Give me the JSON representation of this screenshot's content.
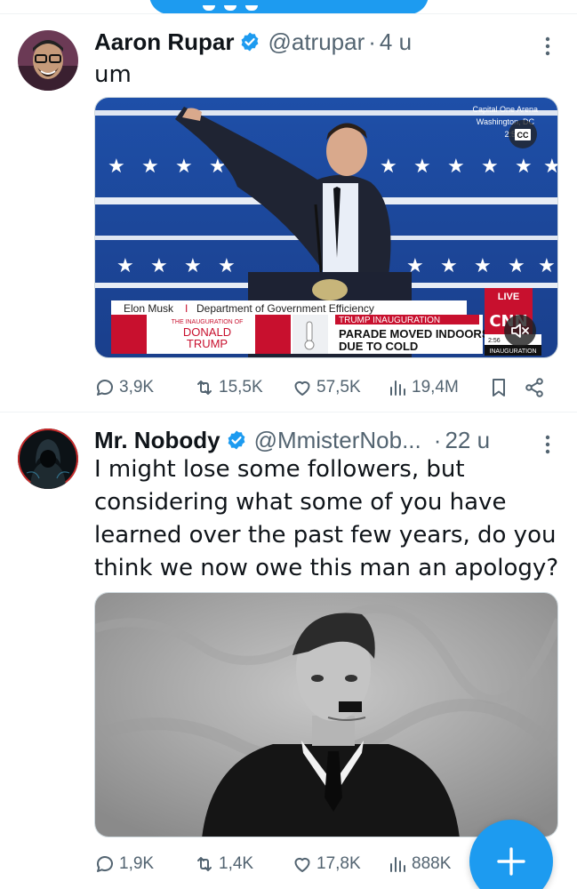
{
  "tweets": [
    {
      "name": "Aaron Rupar",
      "handle": "@atrupar",
      "separator": "·",
      "time": "4 u",
      "text": "um",
      "media": {
        "location_line1": "Capital One Arena",
        "location_line2": "Washington, DC",
        "clock": "2:55",
        "cc_label": "CC",
        "live_label": "LIVE",
        "network_logo": "CNN",
        "chyron_name": "Elon Musk",
        "chyron_divider": "I",
        "chyron_role": "Department of Government Efficiency",
        "inaug_line1": "THE INAUGURATION OF",
        "inaug_line2": "DONALD",
        "inaug_line3": "TRUMP",
        "headline_kicker": "TRUMP INAUGURATION",
        "headline_line1": "PARADE MOVED INDOORS",
        "headline_line2": "DUE TO COLD",
        "bug_time": "2:56",
        "bug_label": "INAUGURATION",
        "mute_icon": "speaker-muted-icon"
      },
      "stats": {
        "replies": "3,9K",
        "reposts": "15,5K",
        "likes": "57,5K",
        "views": "19,4M"
      }
    },
    {
      "name": "Mr. Nobody",
      "handle": "@MmisterNob...",
      "separator": "·",
      "time": "22 u",
      "text": "I might lose some followers, but\nconsidering what some of you have\nlearned over the past few years, do you\nthink we now owe this man an apology?",
      "stats": {
        "replies": "1,9K",
        "reposts": "1,4K",
        "likes": "17,8K",
        "views": "888K"
      }
    }
  ],
  "fab": {
    "label": "+",
    "icon": "compose-plus-icon"
  },
  "colors": {
    "accent": "#1d9bf0",
    "muted": "#536471",
    "text": "#0f1419"
  }
}
